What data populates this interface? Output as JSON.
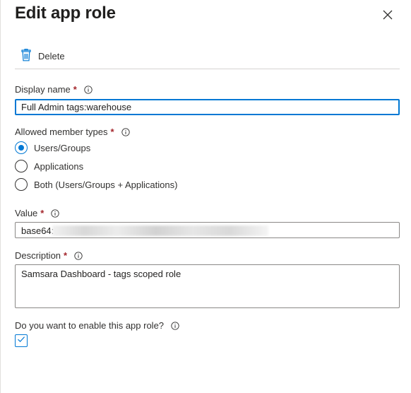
{
  "panel": {
    "title": "Edit app role",
    "close_icon": "close-icon"
  },
  "toolbar": {
    "delete_label": "Delete",
    "delete_icon": "trash-icon"
  },
  "display_name": {
    "label": "Display name",
    "required_mark": "*",
    "value": "Full Admin tags:warehouse"
  },
  "member_types": {
    "label": "Allowed member types",
    "required_mark": "*",
    "options": [
      {
        "label": "Users/Groups",
        "checked": true
      },
      {
        "label": "Applications",
        "checked": false
      },
      {
        "label": "Both (Users/Groups + Applications)",
        "checked": false
      }
    ]
  },
  "value_field": {
    "label": "Value",
    "required_mark": "*",
    "visible_prefix": "base64:"
  },
  "description": {
    "label": "Description",
    "required_mark": "*",
    "value": "Samsara Dashboard - tags scoped role"
  },
  "enable": {
    "label": "Do you want to enable this app role?",
    "checked": true
  },
  "colors": {
    "accent": "#0078d4",
    "required": "#a4262c",
    "text": "#323130"
  }
}
